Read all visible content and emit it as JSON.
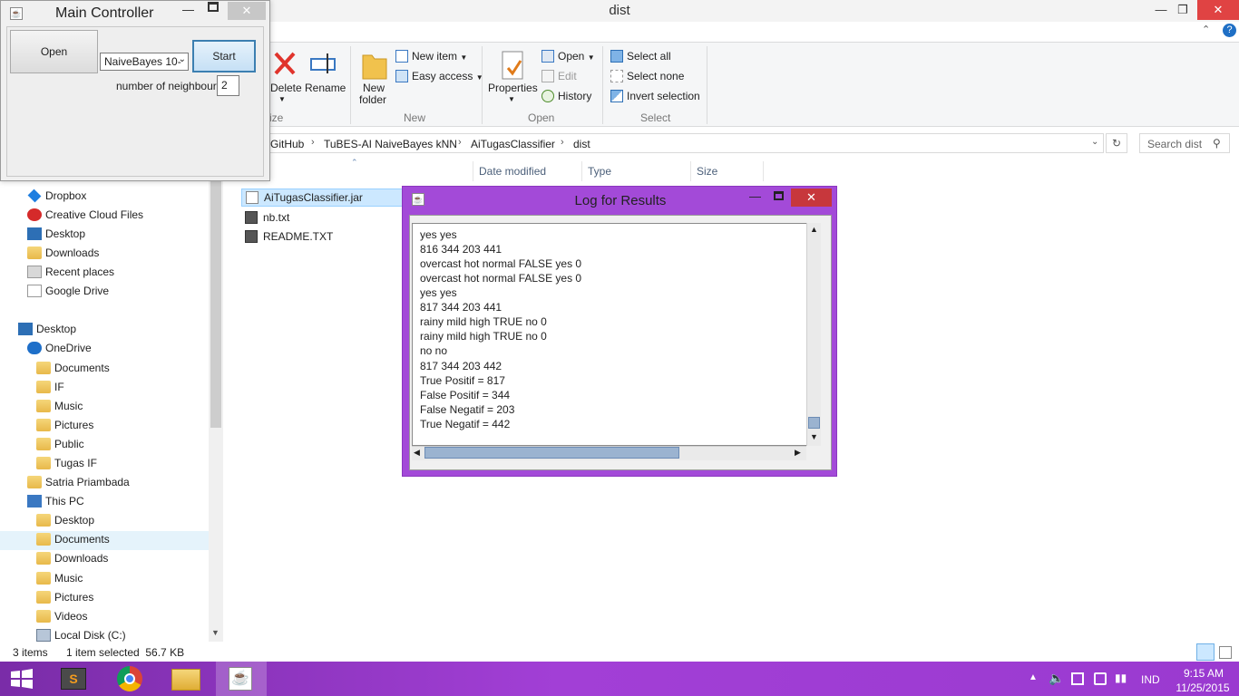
{
  "explorer": {
    "title": "dist",
    "ribbon": {
      "organize_partial_label": "ize",
      "delete_label": "Delete",
      "rename_label": "Rename",
      "new_group_label": "New",
      "new_folder_label_1": "New",
      "new_folder_label_2": "folder",
      "new_item_label": "New item",
      "easy_access_label": "Easy access",
      "open_group_label": "Open",
      "properties_label": "Properties",
      "open_label": "Open",
      "edit_label": "Edit",
      "history_label": "History",
      "select_group_label": "Select",
      "select_all_label": "Select all",
      "select_none_label": "Select none",
      "invert_selection_label": "Invert selection"
    },
    "breadcrumb": [
      "GitHub",
      "TuBES-AI NaiveBayes kNN",
      "AiTugasClassifier",
      "dist"
    ],
    "search_placeholder": "Search dist",
    "columns": [
      "Date modified",
      "Type",
      "Size"
    ],
    "nav": {
      "items_top": [
        "Dropbox",
        "Creative Cloud Files",
        "Desktop",
        "Downloads",
        "Recent places",
        "Google Drive"
      ],
      "desktop": "Desktop",
      "onedrive": "OneDrive",
      "onedrive_children": [
        "Documents",
        "IF",
        "Music",
        "Pictures",
        "Public",
        "Tugas IF"
      ],
      "user": "Satria Priambada",
      "this_pc": "This PC",
      "this_pc_children": [
        "Desktop",
        "Documents",
        "Downloads",
        "Music",
        "Pictures",
        "Videos",
        "Local Disk (C:)"
      ]
    },
    "files": [
      "AiTugasClassifier.jar",
      "nb.txt",
      "README.TXT"
    ],
    "status": {
      "count": "3 items",
      "selection": "1 item selected  56.7 KB"
    }
  },
  "main_controller": {
    "title": "Main Controller",
    "open_button": "Open",
    "algorithm_select": "NaiveBayes 10-",
    "start_button": "Start",
    "neighbour_label": "number of neighbour",
    "neighbour_value": "2"
  },
  "log_window": {
    "title": "Log for Results",
    "lines": [
      "yes yes",
      "816 344 203 441",
      "overcast hot normal FALSE yes 0",
      "overcast hot normal FALSE yes 0",
      "yes yes",
      "817 344 203 441",
      "rainy mild high TRUE no 0",
      "rainy mild high TRUE no 0",
      "no no",
      "817 344 203 442",
      "True Positif = 817",
      "False Positif = 344",
      "False Negatif = 203",
      "True Negatif = 442"
    ]
  },
  "taskbar": {
    "language": "IND",
    "time": "9:15 AM",
    "date": "11/25/2015"
  }
}
